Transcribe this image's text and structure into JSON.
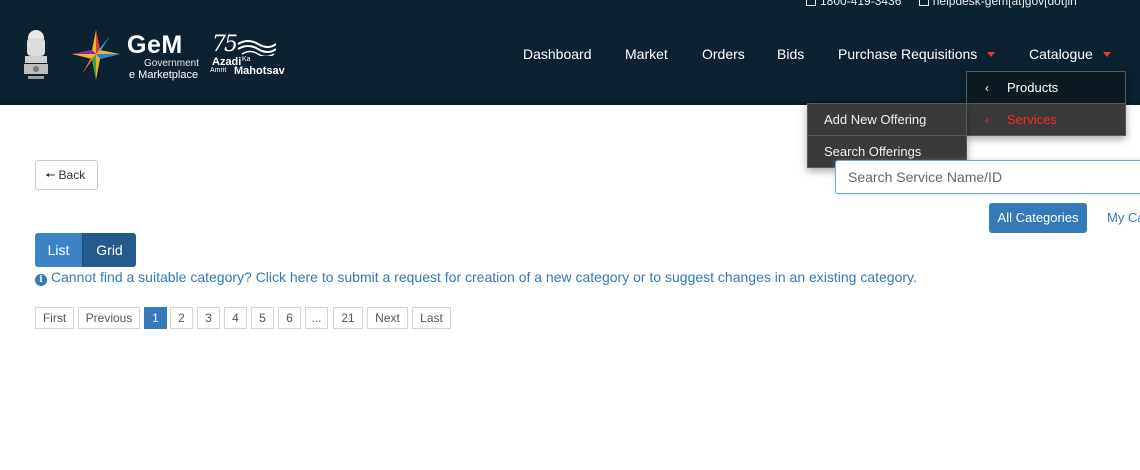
{
  "header": {
    "topbar": {
      "phone": "1800-419-3436",
      "email": "helpdesk-gem[at]gov[dot]in"
    },
    "logo": {
      "title": "GeM",
      "subtitle1": "Government",
      "subtitle2": "e Marketplace"
    },
    "azadi": {
      "number": "75",
      "line1": "Azadi",
      "line1b": "Ka",
      "line2a": "Amrit",
      "line2b": "Mahotsav"
    },
    "nav": [
      {
        "label": "Dashboard"
      },
      {
        "label": "Market"
      },
      {
        "label": "Orders"
      },
      {
        "label": "Bids"
      },
      {
        "label": "Purchase Requisitions"
      },
      {
        "label": "Catalogue"
      }
    ]
  },
  "dropdown": {
    "main": [
      {
        "label": "Products"
      },
      {
        "label": "Services"
      }
    ],
    "sub": [
      {
        "label": "Add New Offering"
      },
      {
        "label": "Search Offerings"
      }
    ]
  },
  "toolbar": {
    "back_label": "Back",
    "search_placeholder": "Search Service Name/ID",
    "all_categories_label": "All Categories",
    "my_categories_label": "My Ca"
  },
  "view": {
    "list_label": "List",
    "grid_label": "Grid"
  },
  "info": {
    "text": "Cannot find a suitable category? Click here to submit a request for creation of a new category or to suggest changes in an existing category."
  },
  "pagination": {
    "first": "First",
    "previous": "Previous",
    "pages": [
      "1",
      "2",
      "3",
      "4",
      "5",
      "6",
      "...",
      "21"
    ],
    "next": "Next",
    "last": "Last",
    "current": "1"
  },
  "colors": {
    "header_bg": "#0c2230",
    "accent_blue": "#337ab7",
    "caret_red": "#e53935",
    "active_dropdown": "#ff2a2a"
  }
}
